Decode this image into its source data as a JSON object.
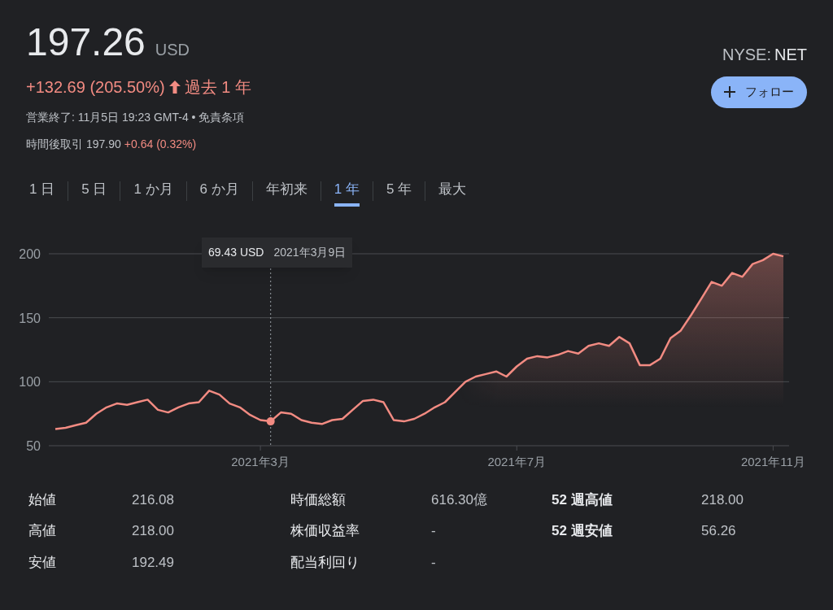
{
  "quote": {
    "price": "197.26",
    "currency": "USD",
    "change": "+132.69 (205.50%)",
    "period": "過去 1 年",
    "exchange_prefix": "NYSE:",
    "symbol": "NET"
  },
  "follow_button": {
    "label": "フォロー"
  },
  "market_status": "営業終了: 11月5日 19:23 GMT-4 • 免責条項",
  "after_hours": {
    "label": "時間後取引",
    "price": "197.90",
    "change": "+0.64 (0.32%)"
  },
  "tabs": [
    {
      "label": "1 日",
      "selected": false
    },
    {
      "label": "5 日",
      "selected": false
    },
    {
      "label": "1 か月",
      "selected": false
    },
    {
      "label": "6 か月",
      "selected": false
    },
    {
      "label": "年初来",
      "selected": false
    },
    {
      "label": "1 年",
      "selected": true
    },
    {
      "label": "5 年",
      "selected": false
    },
    {
      "label": "最大",
      "selected": false
    }
  ],
  "tooltip": {
    "price": "69.43 USD",
    "date": "2021年3月9日"
  },
  "chart": {
    "chart_data": {
      "type": "area",
      "ylim": [
        50,
        200
      ],
      "yticks": [
        50,
        100,
        150,
        200
      ],
      "categories": [
        null,
        null,
        null,
        null,
        null,
        null,
        null,
        null,
        null,
        null,
        null,
        null,
        null,
        null,
        null,
        null,
        null,
        null,
        null,
        null,
        "2021年3月",
        null,
        null,
        null,
        null,
        null,
        null,
        null,
        null,
        null,
        null,
        null,
        null,
        null,
        null,
        null,
        null,
        null,
        null,
        null,
        null,
        null,
        null,
        null,
        null,
        "2021年7月",
        null,
        null,
        null,
        null,
        null,
        null,
        null,
        null,
        null,
        null,
        null,
        null,
        null,
        null,
        null,
        null,
        null,
        null,
        null,
        null,
        null,
        null,
        null,
        null,
        "2021年11月",
        null
      ],
      "series": [
        {
          "color": "#f28b82",
          "values": [
            63,
            64,
            66,
            68,
            75,
            80,
            83,
            82,
            84,
            86,
            78,
            76,
            80,
            83,
            84,
            93,
            90,
            83,
            80,
            74,
            70,
            69,
            76,
            75,
            70,
            68,
            67,
            70,
            71,
            78,
            85,
            86,
            84,
            70,
            69,
            71,
            75,
            80,
            84,
            92,
            100,
            104,
            106,
            108,
            104,
            112,
            118,
            120,
            119,
            121,
            124,
            122,
            128,
            130,
            128,
            135,
            130,
            113,
            113,
            118,
            134,
            140,
            152,
            165,
            178,
            175,
            185,
            182,
            192,
            195,
            200,
            198
          ]
        }
      ]
    }
  },
  "stats": [
    {
      "label": "始値",
      "value": "216.08",
      "emphasis": false
    },
    {
      "label": "時価総額",
      "value": "616.30億",
      "emphasis": false
    },
    {
      "label": "52 週高値",
      "value": "218.00",
      "emphasis": true
    },
    {
      "label": "高値",
      "value": "218.00",
      "emphasis": false
    },
    {
      "label": "株価収益率",
      "value": "-",
      "emphasis": false
    },
    {
      "label": "52 週安値",
      "value": "56.26",
      "emphasis": true
    },
    {
      "label": "安値",
      "value": "192.49",
      "emphasis": false
    },
    {
      "label": "配当利回り",
      "value": "-",
      "emphasis": false
    }
  ]
}
